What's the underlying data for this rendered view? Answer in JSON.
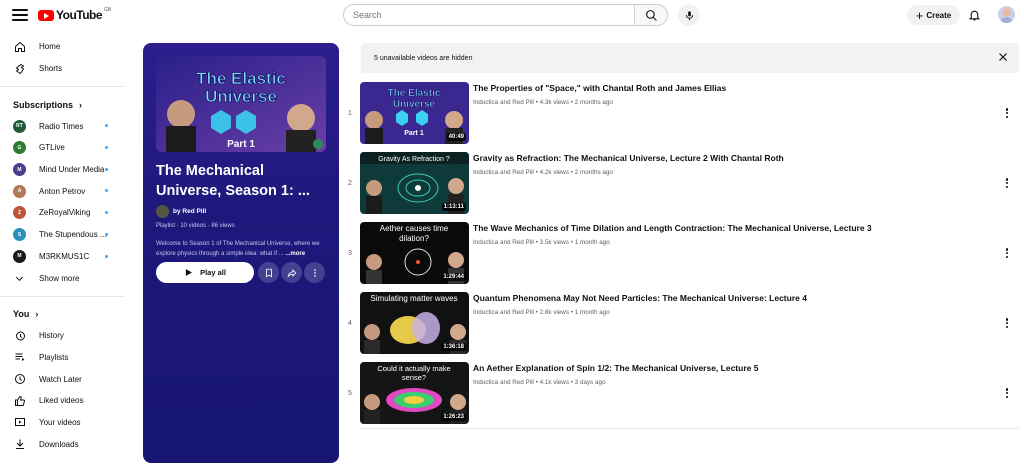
{
  "header": {
    "logo_text": "YouTube",
    "logo_country": "GB",
    "search_placeholder": "Search",
    "create_label": "Create",
    "icons": [
      "menu-icon",
      "search-icon",
      "mic-icon",
      "plus-icon",
      "bell-icon"
    ]
  },
  "sidebar": {
    "main": [
      {
        "label": "Home",
        "icon": "home-icon"
      },
      {
        "label": "Shorts",
        "icon": "shorts-icon"
      }
    ],
    "subscriptions_heading": "Subscriptions",
    "subscriptions": [
      {
        "label": "Radio Times",
        "avatar_text": "RT",
        "color": "#1f5b3a"
      },
      {
        "label": "GTLive",
        "avatar_text": "G",
        "color": "#2e7d32"
      },
      {
        "label": "Mind Under Media",
        "avatar_text": "M",
        "color": "#4a3f8c"
      },
      {
        "label": "Anton Petrov",
        "avatar_text": "A",
        "color": "#b07a5a"
      },
      {
        "label": "ZeRoyalViking",
        "avatar_text": "Z",
        "color": "#c0513a"
      },
      {
        "label": "The Stupendous ...",
        "avatar_text": "S",
        "color": "#2b8fb8"
      },
      {
        "label": "M3RKMUS1C",
        "avatar_text": "M",
        "color": "#1a1a1a"
      }
    ],
    "show_more": "Show more",
    "you_heading": "You",
    "you_items": [
      {
        "label": "History",
        "icon": "history-icon"
      },
      {
        "label": "Playlists",
        "icon": "playlists-icon"
      },
      {
        "label": "Watch Later",
        "icon": "clock-icon"
      },
      {
        "label": "Liked videos",
        "icon": "thumbs-up-icon"
      },
      {
        "label": "Your videos",
        "icon": "video-icon"
      },
      {
        "label": "Downloads",
        "icon": "download-icon"
      }
    ]
  },
  "playlist": {
    "thumb_title_line1": "The Elastic",
    "thumb_title_line2": "Universe",
    "thumb_part": "Part 1",
    "title": "The Mechanical Universe, Season 1: ...",
    "owner": "by Red Pill",
    "meta": "Playlist · 10 videos · 86 views",
    "description": "Welcome to Season 1 of The Mechanical Universe, where we explore physics through a simple idea: what if ...",
    "more_label": "...more",
    "play_all_label": "Play all"
  },
  "hidden_notice": "5 unavailable videos are hidden",
  "videos": [
    {
      "index": "1",
      "title": "The Properties of \"Space,\" with Chantal Roth and James Ellias",
      "meta": "Inductica and Red Pill • 4.3k views • 2 months ago",
      "duration": "40:49",
      "thumb_text": "The Elastic Universe",
      "thumb_sub": "Part 1"
    },
    {
      "index": "2",
      "title": "Gravity as Refraction: The Mechanical Universe, Lecture 2 With Chantal Roth",
      "meta": "Inductica and Red Pill • 4.2k views • 2 months ago",
      "duration": "1:13:11",
      "thumb_text": "Gravity As Refraction ?"
    },
    {
      "index": "3",
      "title": "The Wave Mechanics of Time Dilation and Length Contraction: The Mechanical Universe, Lecture 3",
      "meta": "Inductica and Red Pill • 3.5k views • 1 month ago",
      "duration": "1:29:44",
      "thumb_text": "Aether causes time dilation?"
    },
    {
      "index": "4",
      "title": "Quantum Phenomena May Not Need Particles: The Mechanical Universe: Lecture 4",
      "meta": "Inductica and Red Pill • 2.8k views • 1 month ago",
      "duration": "1:36:18",
      "thumb_text": "Simulating matter waves"
    },
    {
      "index": "5",
      "title": "An Aether Explanation of Spin 1/2: The Mechanical Universe, Lecture 5",
      "meta": "Inductica and Red Pill • 4.1k views • 3 days ago",
      "duration": "1:26:23",
      "thumb_text": "Could it actually make sense?"
    }
  ]
}
